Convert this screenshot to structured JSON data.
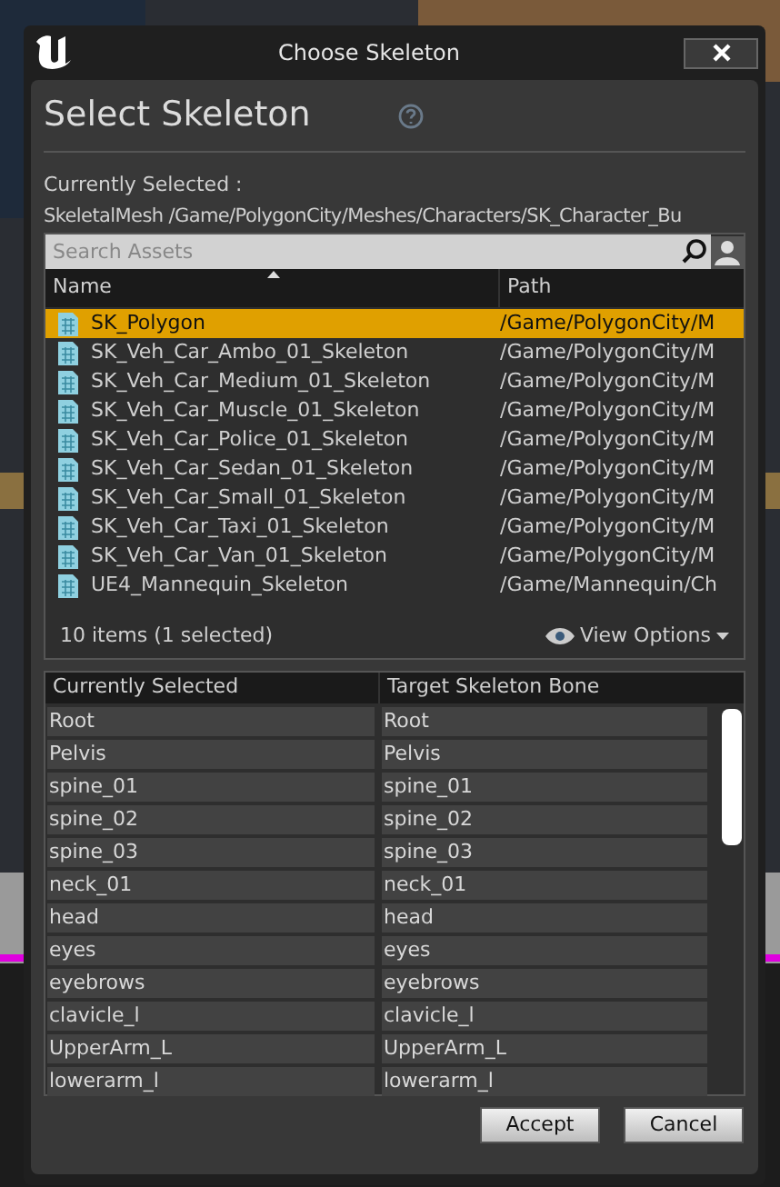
{
  "window": {
    "title": "Choose Skeleton"
  },
  "heading": "Select Skeleton",
  "current_label": "Currently Selected :",
  "current_path": "SkeletalMesh /Game/PolygonCity/Meshes/Characters/SK_Character_Bu",
  "search": {
    "placeholder": "Search Assets"
  },
  "assets": {
    "columns": [
      "Name",
      "Path"
    ],
    "rows": [
      {
        "name": "SK_Polygon",
        "path": "/Game/PolygonCity/M",
        "selected": true
      },
      {
        "name": "SK_Veh_Car_Ambo_01_Skeleton",
        "path": "/Game/PolygonCity/M",
        "selected": false
      },
      {
        "name": "SK_Veh_Car_Medium_01_Skeleton",
        "path": "/Game/PolygonCity/M",
        "selected": false
      },
      {
        "name": "SK_Veh_Car_Muscle_01_Skeleton",
        "path": "/Game/PolygonCity/M",
        "selected": false
      },
      {
        "name": "SK_Veh_Car_Police_01_Skeleton",
        "path": "/Game/PolygonCity/M",
        "selected": false
      },
      {
        "name": "SK_Veh_Car_Sedan_01_Skeleton",
        "path": "/Game/PolygonCity/M",
        "selected": false
      },
      {
        "name": "SK_Veh_Car_Small_01_Skeleton",
        "path": "/Game/PolygonCity/M",
        "selected": false
      },
      {
        "name": "SK_Veh_Car_Taxi_01_Skeleton",
        "path": "/Game/PolygonCity/M",
        "selected": false
      },
      {
        "name": "SK_Veh_Car_Van_01_Skeleton",
        "path": "/Game/PolygonCity/M",
        "selected": false
      },
      {
        "name": "UE4_Mannequin_Skeleton",
        "path": "/Game/Mannequin/Ch",
        "selected": false
      }
    ],
    "count": "10 items (1 selected)",
    "view_options": "View Options"
  },
  "bones": {
    "columns": [
      "Currently Selected",
      "Target Skeleton Bone"
    ],
    "rows": [
      [
        "Root",
        "Root"
      ],
      [
        "Pelvis",
        "Pelvis"
      ],
      [
        "spine_01",
        "spine_01"
      ],
      [
        "spine_02",
        "spine_02"
      ],
      [
        "spine_03",
        "spine_03"
      ],
      [
        "neck_01",
        "neck_01"
      ],
      [
        "head",
        "head"
      ],
      [
        "eyes",
        "eyes"
      ],
      [
        "eyebrows",
        "eyebrows"
      ],
      [
        "clavicle_l",
        "clavicle_l"
      ],
      [
        "UpperArm_L",
        "UpperArm_L"
      ],
      [
        "lowerarm_l",
        "lowerarm_l"
      ]
    ]
  },
  "buttons": [
    "Accept",
    "Cancel"
  ]
}
